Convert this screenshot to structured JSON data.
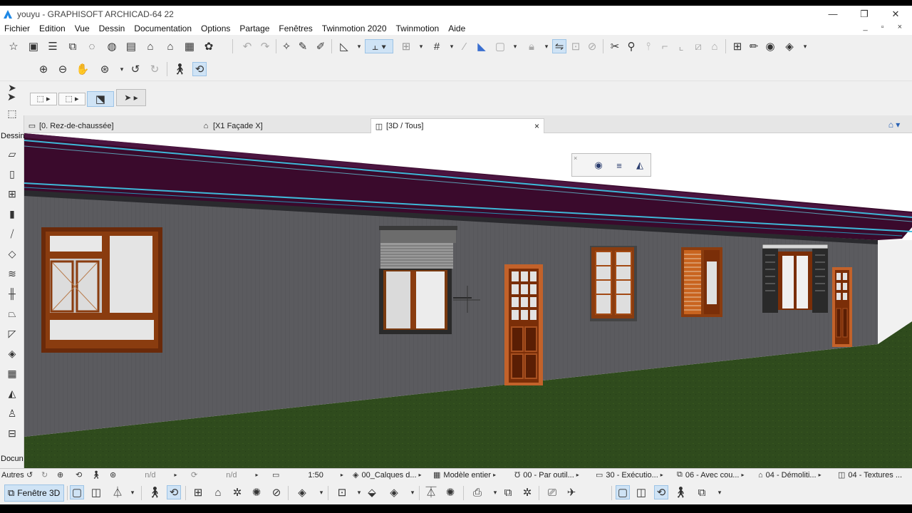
{
  "window": {
    "title": "youyu - GRAPHISOFT ARCHICAD-64 22",
    "minimize": "—",
    "restore": "❐",
    "close": "✕"
  },
  "menu": {
    "items": [
      "Fichier",
      "Edition",
      "Vue",
      "Dessin",
      "Documentation",
      "Options",
      "Partage",
      "Fenêtres",
      "Twinmotion 2020",
      "Twinmotion",
      "Aide"
    ],
    "doc_controls": "_ ▫ ×"
  },
  "toolbox": {
    "label_dessin": "Dessin",
    "label_docun": "Docun",
    "label_autres": "Autres"
  },
  "tabs": [
    {
      "label": "[0. Rez-de-chaussée]",
      "icon": "floor-plan-icon"
    },
    {
      "label": "[X1 Façade X]",
      "icon": "elevation-icon"
    },
    {
      "label": "[3D / Tous]",
      "icon": "3d-box-icon",
      "close": "×"
    }
  ],
  "statusbar": {
    "nd1": "n/d",
    "nd2": "n/d",
    "scale": "1:50",
    "layers": "00_Calques d...",
    "model": "Modèle entier",
    "pen": "00 - Par outil...",
    "mvo": "30 - Exécutio...",
    "override": "06 - Avec cou...",
    "renovation": "04 - Démoliti...",
    "textures": "04 - Textures ..."
  },
  "bottombar": {
    "window3d_label": "Fenêtre 3D"
  },
  "colors": {
    "accent": "#cfe3f5",
    "roof": "#3a0a2c",
    "wall": "#5a5a5e",
    "grass": "#2e4a1c",
    "wood": "#8a3c0f"
  }
}
